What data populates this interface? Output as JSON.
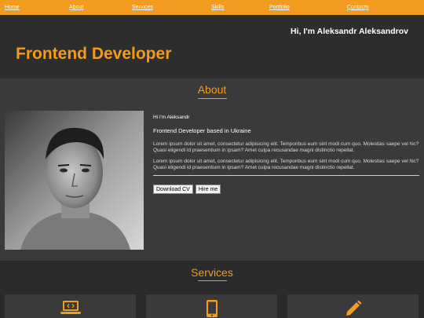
{
  "nav": {
    "items": [
      {
        "label": "Home"
      },
      {
        "label": "About"
      },
      {
        "label": "Services"
      },
      {
        "label": "Skills"
      },
      {
        "label": "Portfolio"
      },
      {
        "label": "Contacts"
      }
    ]
  },
  "hero": {
    "greeting": "Hi, I'm Aleksandr Aleksandrov",
    "title": "Frontend Developer"
  },
  "about": {
    "heading": "About",
    "hi": "Hi i'm Aleksandr",
    "subtitle": "Frontend Developer based in Ukraine",
    "paragraph1": "Lorem ipsum dolor sit amet, consectetur adipisicing elit. Temporibus eum sint modi cum quo. Molestias saepe vel hic? Quasi eligendi id praesentium in ipsam? Amet culpa recusandae magni distinctio repellat.",
    "paragraph2": "Lorem ipsum dolor sit amet, consectetur adipisicing elit. Temporibus eum sint modi cum quo. Molestias saepe vel hic? Quasi eligendi id praesentium in ipsam? Amet culpa recusandae magni distinctio repellat.",
    "download_cv": "Download CV",
    "hire_me": "Hire me"
  },
  "services": {
    "heading": "Services",
    "cards": [
      {
        "icon": "laptop-code-icon"
      },
      {
        "icon": "mobile-phone-icon"
      },
      {
        "icon": "pencil-icon"
      }
    ]
  },
  "colors": {
    "accent": "#f19b1f",
    "background": "#2c2c2c",
    "section": "#3a3a3a"
  }
}
